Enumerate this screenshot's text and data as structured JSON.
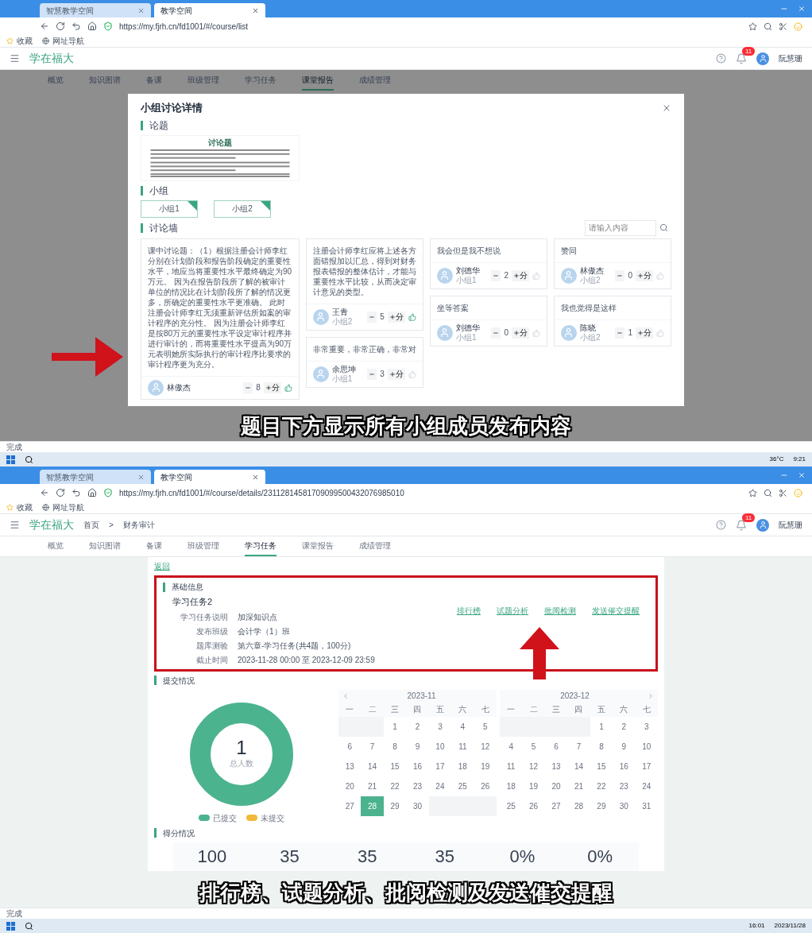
{
  "top_capture": {
    "browser": {
      "tabs": [
        {
          "label": "智慧教学空间",
          "selected": false
        },
        {
          "label": "教学空间",
          "selected": true
        }
      ],
      "url": "https://my.fjrh.cn/fd1001/#/course/list",
      "bookmarks": [
        "收藏",
        "网址导航"
      ]
    },
    "app": {
      "brand": "学在福大",
      "notification_count": "11",
      "user": "阮慧珊",
      "nav": [
        {
          "label": "概览",
          "selected": false
        },
        {
          "label": "知识图谱",
          "selected": false
        },
        {
          "label": "备课",
          "selected": false
        },
        {
          "label": "班级管理",
          "selected": false
        },
        {
          "label": "学习任务",
          "selected": false
        },
        {
          "label": "课堂报告",
          "selected": true
        },
        {
          "label": "成绩管理",
          "selected": false
        }
      ]
    },
    "modal": {
      "title": "小组讨论详情",
      "topic_heading": "论题",
      "topic_document_title": "讨论题",
      "groups_heading": "小组",
      "groups": [
        {
          "label": "小组1",
          "checked": true
        },
        {
          "label": "小组2",
          "checked": true
        }
      ],
      "wall_heading": "讨论墙",
      "search_placeholder": "请输入内容",
      "columns": [
        [
          {
            "text": "课中讨论题：（1）根据注册会计师李红分别在计划阶段和报告阶段确定的重要性水平，地应当将重要性水平最终确定为90万元。 因为在报告阶段所了解的被审计单位的情况比在计划阶段所了解的情况更多，所确定的重要性水平更准确。 此时注册会计师李红无须重新评估所如案的审计程序的充分性。 因为注册会计师李红是按80万元的重要性水平设定审计程序并进行审计的，而将重要性水平提高为90万元表明她所实际执行的审计程序比要求的审计程序更为充分。",
            "author": "林傲杰",
            "score": "8",
            "unit": "分",
            "liked": true
          }
        ],
        [
          {
            "text": "注册会计师李红应将上述各方面错报加以汇总，得到对财务报表错报的整体估计，才能与重要性水平比较，从而决定审计意见的类型。",
            "author": "王青",
            "group": "小组2",
            "score": "5",
            "unit": "分",
            "liked": true
          },
          {
            "text": "非常重要，非常正确，非常对",
            "author": "余思坤",
            "group": "小组1",
            "score": "3",
            "unit": "分",
            "liked": false
          }
        ],
        [
          {
            "text": "我会但是我不想说",
            "author": "刘德华",
            "group": "小组1",
            "score": "2",
            "unit": "分",
            "liked": false
          },
          {
            "text": "坐等答案",
            "author": "刘德华",
            "group": "小组1",
            "score": "0",
            "unit": "分",
            "liked": false
          }
        ],
        [
          {
            "text": "赞同",
            "author": "林傲杰",
            "group": "小组2",
            "score": "0",
            "unit": "分",
            "liked": false
          },
          {
            "text": "我也觉得是这样",
            "author": "陈晓",
            "group": "小组2",
            "score": "1",
            "unit": "分",
            "liked": false
          }
        ]
      ]
    },
    "caption": "题目下方显示所有小组成员发布内容",
    "status": "完成",
    "taskbar": {
      "weather": "36°C",
      "time": "9:21"
    }
  },
  "bottom_capture": {
    "browser": {
      "tabs": [
        {
          "label": "智慧教学空间",
          "selected": false
        },
        {
          "label": "教学空间",
          "selected": true
        }
      ],
      "url": "https://my.fjrh.cn/fd1001/#/course/details/23112814581709099500432076985010",
      "bookmarks": [
        "收藏",
        "网址导航"
      ]
    },
    "app": {
      "brand": "学在福大",
      "breadcrumb": [
        "首页",
        ">",
        "财务审计"
      ],
      "notification_count": "11",
      "user": "阮慧珊",
      "nav": [
        {
          "label": "概览",
          "selected": false
        },
        {
          "label": "知识图谱",
          "selected": false
        },
        {
          "label": "备课",
          "selected": false
        },
        {
          "label": "班级管理",
          "selected": false
        },
        {
          "label": "学习任务",
          "selected": true
        },
        {
          "label": "课堂报告",
          "selected": false
        },
        {
          "label": "成绩管理",
          "selected": false
        }
      ]
    },
    "back_link": "返回",
    "info": {
      "heading": "基础信息",
      "task_name": "学习任务2",
      "fields": [
        {
          "label": "学习任务说明",
          "value": "加深知识点"
        },
        {
          "label": "发布班级",
          "value": "会计学（1）班"
        },
        {
          "label": "题库测验",
          "value": "第六章-学习任务(共4题，100分)"
        },
        {
          "label": "截止时间",
          "value": "2023-11-28 00:00 至 2023-12-09 23:59"
        }
      ],
      "links": [
        "排行榜",
        "试题分析",
        "批阅检测",
        "发送催交提醒"
      ]
    },
    "submission": {
      "heading": "提交情况",
      "total": "1",
      "total_label": "总人数",
      "legend": [
        {
          "label": "已提交",
          "color": "#4cb38f"
        },
        {
          "label": "未提交",
          "color": "#f0b93a"
        }
      ],
      "months": [
        {
          "title": "2023-11",
          "weekdays": [
            "一",
            "二",
            "三",
            "四",
            "五",
            "六",
            "七"
          ],
          "cells": [
            {
              "kind": "blank"
            },
            {
              "kind": "blank"
            },
            {
              "kind": "day",
              "label": "1",
              "selected": false
            },
            {
              "kind": "day",
              "label": "2",
              "selected": false
            },
            {
              "kind": "day",
              "label": "3",
              "selected": false
            },
            {
              "kind": "day",
              "label": "4",
              "selected": false
            },
            {
              "kind": "day",
              "label": "5",
              "selected": false
            },
            {
              "kind": "day",
              "label": "6",
              "selected": false
            },
            {
              "kind": "day",
              "label": "7",
              "selected": false
            },
            {
              "kind": "day",
              "label": "8",
              "selected": false
            },
            {
              "kind": "day",
              "label": "9",
              "selected": false
            },
            {
              "kind": "day",
              "label": "10",
              "selected": false
            },
            {
              "kind": "day",
              "label": "11",
              "selected": false
            },
            {
              "kind": "day",
              "label": "12",
              "selected": false
            },
            {
              "kind": "day",
              "label": "13",
              "selected": false
            },
            {
              "kind": "day",
              "label": "14",
              "selected": false
            },
            {
              "kind": "day",
              "label": "15",
              "selected": false
            },
            {
              "kind": "day",
              "label": "16",
              "selected": false
            },
            {
              "kind": "day",
              "label": "17",
              "selected": false
            },
            {
              "kind": "day",
              "label": "18",
              "selected": false
            },
            {
              "kind": "day",
              "label": "19",
              "selected": false
            },
            {
              "kind": "day",
              "label": "20",
              "selected": false
            },
            {
              "kind": "day",
              "label": "21",
              "selected": false
            },
            {
              "kind": "day",
              "label": "22",
              "selected": false
            },
            {
              "kind": "day",
              "label": "23",
              "selected": false
            },
            {
              "kind": "day",
              "label": "24",
              "selected": false
            },
            {
              "kind": "day",
              "label": "25",
              "selected": false
            },
            {
              "kind": "day",
              "label": "26",
              "selected": false
            },
            {
              "kind": "day",
              "label": "27",
              "selected": false
            },
            {
              "kind": "day",
              "label": "28",
              "selected": true
            },
            {
              "kind": "day",
              "label": "29",
              "selected": false
            },
            {
              "kind": "day",
              "label": "30",
              "selected": false
            },
            {
              "kind": "blank"
            },
            {
              "kind": "blank"
            },
            {
              "kind": "blank"
            }
          ]
        },
        {
          "title": "2023-12",
          "weekdays": [
            "一",
            "二",
            "三",
            "四",
            "五",
            "六",
            "七"
          ],
          "cells": [
            {
              "kind": "blank"
            },
            {
              "kind": "blank"
            },
            {
              "kind": "blank"
            },
            {
              "kind": "blank"
            },
            {
              "kind": "day",
              "label": "1",
              "selected": false
            },
            {
              "kind": "day",
              "label": "2",
              "selected": false
            },
            {
              "kind": "day",
              "label": "3",
              "selected": false
            },
            {
              "kind": "day",
              "label": "4",
              "selected": false
            },
            {
              "kind": "day",
              "label": "5",
              "selected": false
            },
            {
              "kind": "day",
              "label": "6",
              "selected": false
            },
            {
              "kind": "day",
              "label": "7",
              "selected": false
            },
            {
              "kind": "day",
              "label": "8",
              "selected": false
            },
            {
              "kind": "day",
              "label": "9",
              "selected": false
            },
            {
              "kind": "day",
              "label": "10",
              "selected": false
            },
            {
              "kind": "day",
              "label": "11",
              "selected": false
            },
            {
              "kind": "day",
              "label": "12",
              "selected": false
            },
            {
              "kind": "day",
              "label": "13",
              "selected": false
            },
            {
              "kind": "day",
              "label": "14",
              "selected": false
            },
            {
              "kind": "day",
              "label": "15",
              "selected": false
            },
            {
              "kind": "day",
              "label": "16",
              "selected": false
            },
            {
              "kind": "day",
              "label": "17",
              "selected": false
            },
            {
              "kind": "day",
              "label": "18",
              "selected": false
            },
            {
              "kind": "day",
              "label": "19",
              "selected": false
            },
            {
              "kind": "day",
              "label": "20",
              "selected": false
            },
            {
              "kind": "day",
              "label": "21",
              "selected": false
            },
            {
              "kind": "day",
              "label": "22",
              "selected": false
            },
            {
              "kind": "day",
              "label": "23",
              "selected": false
            },
            {
              "kind": "day",
              "label": "24",
              "selected": false
            },
            {
              "kind": "day",
              "label": "25",
              "selected": false
            },
            {
              "kind": "day",
              "label": "26",
              "selected": false
            },
            {
              "kind": "day",
              "label": "27",
              "selected": false
            },
            {
              "kind": "day",
              "label": "28",
              "selected": false
            },
            {
              "kind": "day",
              "label": "29",
              "selected": false
            },
            {
              "kind": "day",
              "label": "30",
              "selected": false
            },
            {
              "kind": "day",
              "label": "31",
              "selected": false
            }
          ]
        }
      ]
    },
    "scores": {
      "heading": "得分情况",
      "values": [
        "100",
        "35",
        "35",
        "35",
        "0%",
        "0%"
      ]
    },
    "caption": "排行榜、试题分析、批阅检测及发送催交提醒",
    "status": "完成",
    "taskbar": {
      "time": "16:01",
      "date": "2023/11/28"
    }
  }
}
